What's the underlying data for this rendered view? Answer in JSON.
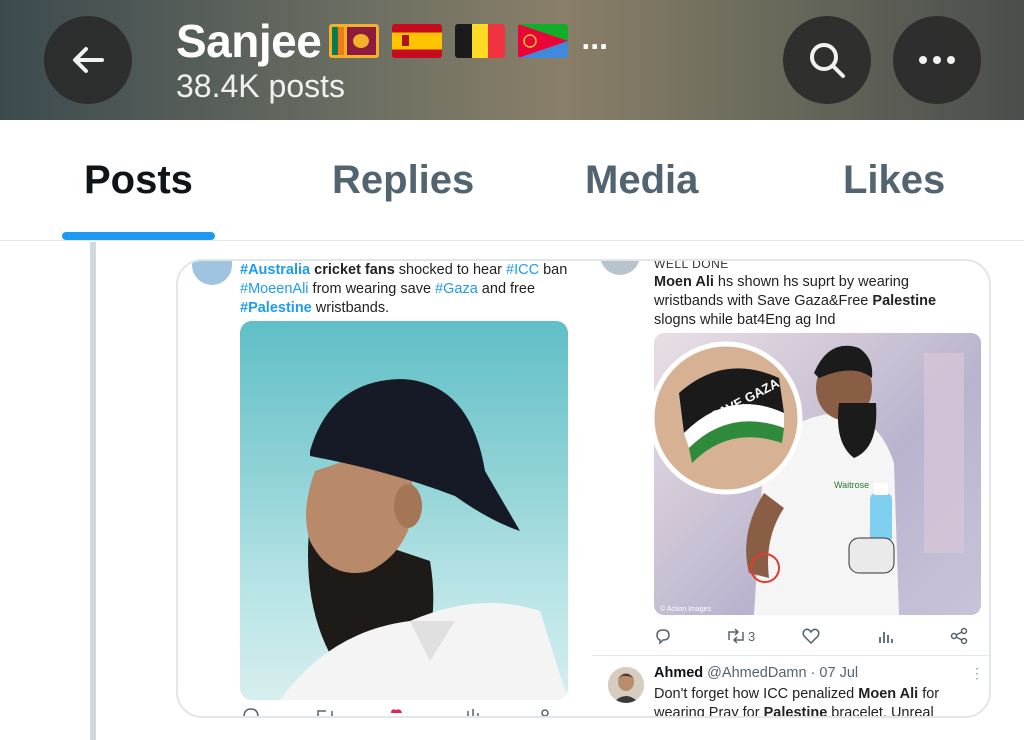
{
  "header": {
    "name": "Sanjee",
    "flags": [
      "Sri Lanka flag",
      "Spain flag",
      "Belgium flag",
      "Eritrea flag"
    ],
    "more_indicator": "...",
    "posts_count": "38.4K posts",
    "icons": {
      "back": "back-arrow-icon",
      "search": "search-icon",
      "more": "more-options-icon"
    }
  },
  "tabs": [
    {
      "label": "Posts",
      "active": true
    },
    {
      "label": "Replies",
      "active": false
    },
    {
      "label": "Media",
      "active": false
    },
    {
      "label": "Likes",
      "active": false
    }
  ],
  "card": {
    "left_post": {
      "text_parts": {
        "h1": "#Australia",
        "t1": " cricket fans",
        "t2": " shocked to hear ",
        "h2": "#ICC",
        "t3": " ban",
        "h3": "#MoeenAli",
        "t4": "  from wearing save ",
        "h4": "#Gaza",
        "t5": " and free",
        "h5": "#Palestine",
        "t6": " wristbands."
      }
    },
    "right_post": {
      "header_fragment": "WELL DONE",
      "text_parts": {
        "b1": "Moen Ali",
        "t1": " hs shown hs suprt by wearing wristbands with Save Gaza&Free ",
        "b2": "Palestine",
        "t2": " slogns while bat4Eng ag Ind"
      },
      "photo_credit": "© Action Images",
      "wristband_text": "SAVE GAZA",
      "shirt_text": "Waitrose",
      "actions": {
        "retweets": "3"
      }
    },
    "reply": {
      "name": "Ahmed",
      "handle_date": " @AhmedDamn · 07 Jul",
      "text_parts": {
        "t1": "Don't forget how ICC penalized ",
        "b1": "Moen Ali",
        "t2": " for wearing Pray for ",
        "b2": "Palestine",
        "t3": " bracelet. Unreal"
      },
      "more": "⋮"
    }
  }
}
